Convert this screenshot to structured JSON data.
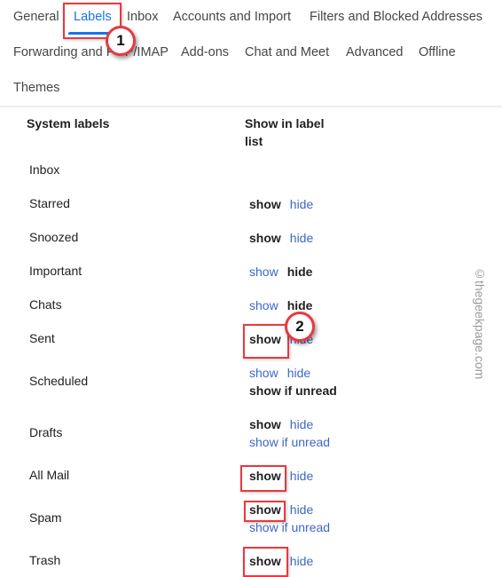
{
  "tabs": [
    {
      "label": "General",
      "active": false
    },
    {
      "label": "Labels",
      "active": true
    },
    {
      "label": "Inbox",
      "active": false
    },
    {
      "label": "Accounts and Import",
      "active": false
    },
    {
      "label": "Filters and Blocked Addresses",
      "active": false
    },
    {
      "label": "Forwarding and POP/IMAP",
      "active": false
    },
    {
      "label": "Add-ons",
      "active": false
    },
    {
      "label": "Chat and Meet",
      "active": false
    },
    {
      "label": "Advanced",
      "active": false
    },
    {
      "label": "Offline",
      "active": false
    },
    {
      "label": "Themes",
      "active": false
    }
  ],
  "table": {
    "col1_header": "System labels",
    "col2_header_line1": "Show in label",
    "col2_header_line2": "list",
    "rows": [
      {
        "label": "Inbox"
      },
      {
        "label": "Starred",
        "show": "show",
        "hide": "hide",
        "selected": "show"
      },
      {
        "label": "Snoozed",
        "show": "show",
        "hide": "hide",
        "selected": "show"
      },
      {
        "label": "Important",
        "show": "show",
        "hide": "hide",
        "selected": "hide"
      },
      {
        "label": "Chats",
        "show": "show",
        "hide": "hide",
        "selected": "hide"
      },
      {
        "label": "Sent",
        "show": "show",
        "hide": "hide",
        "selected": "show"
      },
      {
        "label": "Scheduled",
        "show": "show",
        "hide": "hide",
        "unread": "show if unread",
        "selected": "show if unread"
      },
      {
        "label": "Drafts",
        "show": "show",
        "hide": "hide",
        "unread": "show if unread",
        "selected": "show"
      },
      {
        "label": "All Mail",
        "show": "show",
        "hide": "hide",
        "selected": "show"
      },
      {
        "label": "Spam",
        "show": "show",
        "hide": "hide",
        "unread": "show if unread",
        "selected": "show"
      },
      {
        "label": "Trash",
        "show": "show",
        "hide": "hide",
        "selected": "show"
      }
    ]
  },
  "annotations": {
    "step1": "1",
    "step2": "2"
  },
  "watermark": "©thegeekpage.com",
  "colors": {
    "accent": "#1a73e8",
    "link": "#3c67c8",
    "highlight": "#e8393f"
  }
}
